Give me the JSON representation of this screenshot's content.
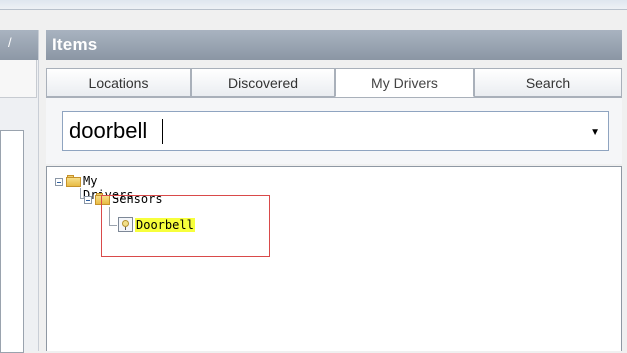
{
  "left_panel": {
    "header_glyph": "/"
  },
  "items_panel": {
    "title": "Items",
    "tabs": [
      {
        "label": "Locations",
        "active": false
      },
      {
        "label": "Discovered",
        "active": false
      },
      {
        "label": "My Drivers",
        "active": true
      },
      {
        "label": "Search",
        "active": false
      }
    ],
    "search": {
      "value": "doorbell",
      "dropdown_icon": "chevron-down-icon"
    },
    "tree": {
      "root": {
        "label": "My Drivers",
        "icon": "folder-icon",
        "expanded": true
      },
      "child": {
        "label": "Sensors",
        "icon": "folder-icon",
        "expanded": true
      },
      "leaf": {
        "label": "Doorbell",
        "icon": "sensor-icon",
        "highlighted": true
      }
    }
  },
  "colors": {
    "header": "#98a3b1",
    "selection_border": "#d94a4a",
    "highlight": "#f7ff3c"
  }
}
